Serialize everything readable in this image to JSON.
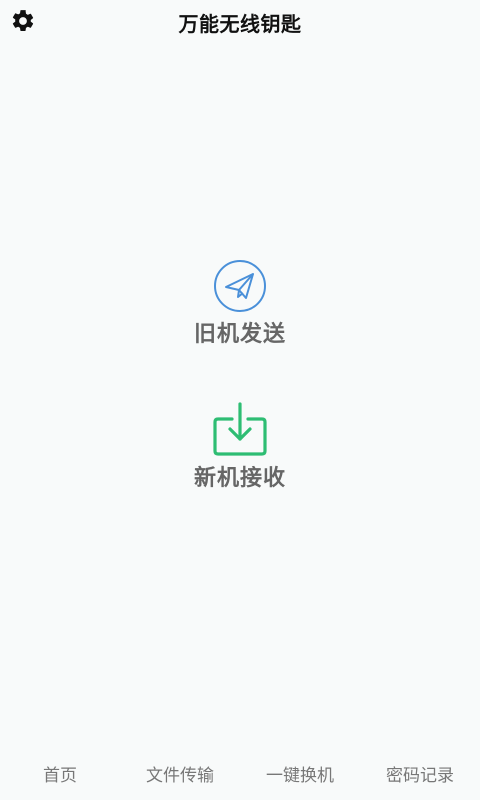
{
  "header": {
    "title": "万能无线钥匙",
    "settings_icon": "gear-icon"
  },
  "actions": {
    "send": {
      "label": "旧机发送",
      "icon": "paper-plane-icon",
      "color": "#4a90d9"
    },
    "receive": {
      "label": "新机接收",
      "icon": "download-tray-icon",
      "color": "#2ebd73"
    }
  },
  "bottom_nav": [
    {
      "label": "首页"
    },
    {
      "label": "文件传输"
    },
    {
      "label": "一键换机"
    },
    {
      "label": "密码记录"
    }
  ]
}
